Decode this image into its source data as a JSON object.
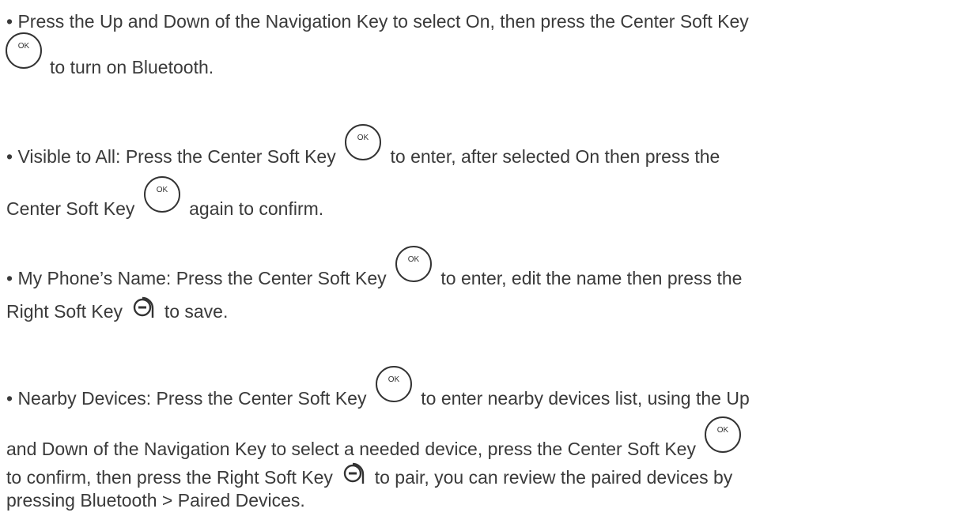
{
  "bullets": [
    {
      "segments": [
        "• Press the Up and Down of the Navigation Key to select On, then press the Center Soft Key",
        "to turn on Bluetooth."
      ]
    },
    {
      "segments": [
        "• Visible to All: Press the Center Soft Key",
        "to enter, after selected On then press the",
        "Center Soft Key",
        "again to confirm."
      ]
    },
    {
      "segments": [
        "• My Phone’s Name: Press the Center Soft Key",
        "to enter, edit the name then press the",
        "Right Soft Key",
        "to save."
      ]
    },
    {
      "segments": [
        "• Nearby Devices: Press the Center Soft Key",
        "to enter nearby devices list, using the Up",
        "and Down of the Navigation Key to select a needed device, press the Center Soft Key",
        "to confirm, then press the Right Soft Key",
        "to pair, you can review the paired devices by",
        "pressing Bluetooth > Paired Devices."
      ]
    }
  ],
  "icons": {
    "center_soft_key": {
      "name": "ok-key-icon",
      "label": "OK"
    },
    "right_soft_key": {
      "name": "right-soft-key-icon"
    }
  }
}
